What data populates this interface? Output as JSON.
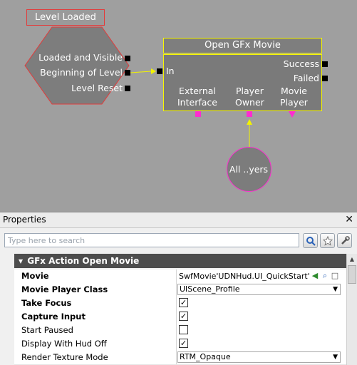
{
  "canvas": {
    "event_node": {
      "title": "Level Loaded",
      "outputs": [
        "Loaded and Visible",
        "Beginning of Level",
        "Level Reset"
      ]
    },
    "action_node": {
      "title": "Open GFx Movie",
      "input": "In",
      "outputs": [
        "Success",
        "Failed"
      ],
      "variable_links": [
        "External\nInterface",
        "Player\nOwner",
        "Movie\nPlayer"
      ]
    },
    "variable_node": {
      "label": "All ..yers"
    }
  },
  "properties": {
    "title": "Properties",
    "close": "✕",
    "search_placeholder": "Type here to search",
    "category": "GFx Action Open Movie",
    "rows": [
      {
        "name": "Movie",
        "value": "SwfMovie'UDNHud.UI_QuickStart'"
      },
      {
        "name": "Movie Player Class",
        "value": "UIScene_Profile"
      },
      {
        "name": "Take Focus",
        "value": "✓"
      },
      {
        "name": "Capture Input",
        "value": "✓"
      },
      {
        "name": "Start Paused",
        "value": ""
      },
      {
        "name": "Display With Hud Off",
        "value": "✓"
      },
      {
        "name": "Render Texture Mode",
        "value": "RTM_Opaque"
      }
    ]
  },
  "colors": {
    "event_border": "#e23b3b",
    "action_border": "#f7f700",
    "variable_pin": "#ff2bd1"
  }
}
